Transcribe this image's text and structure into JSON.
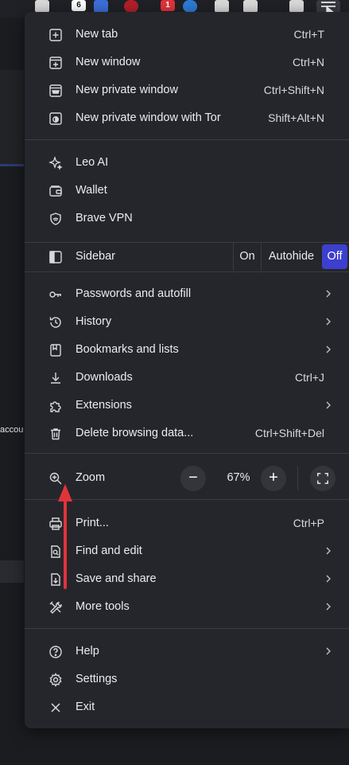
{
  "toolbar": {
    "badges": [
      "6",
      "1"
    ],
    "colors": {
      "bg": "#202126",
      "badge_red": "#e0343b"
    }
  },
  "background": {
    "partial_text": "accoun"
  },
  "menu": {
    "group1": [
      {
        "icon": "new-tab-icon",
        "label": "New tab",
        "shortcut": "Ctrl+T"
      },
      {
        "icon": "new-window-icon",
        "label": "New window",
        "shortcut": "Ctrl+N"
      },
      {
        "icon": "private-window-icon",
        "label": "New private window",
        "shortcut": "Ctrl+Shift+N"
      },
      {
        "icon": "tor-window-icon",
        "label": "New private window with Tor",
        "shortcut": "Shift+Alt+N"
      }
    ],
    "group2": [
      {
        "icon": "sparkle-icon",
        "label": "Leo AI"
      },
      {
        "icon": "wallet-icon",
        "label": "Wallet"
      },
      {
        "icon": "vpn-shield-icon",
        "label": "Brave VPN"
      }
    ],
    "sidebar": {
      "label": "Sidebar",
      "options": [
        "On",
        "Autohide",
        "Off"
      ],
      "selected": "Off",
      "accent": "#3d3fcf"
    },
    "group3": [
      {
        "icon": "key-icon",
        "label": "Passwords and autofill",
        "submenu": true
      },
      {
        "icon": "history-icon",
        "label": "History",
        "submenu": true
      },
      {
        "icon": "bookmark-icon",
        "label": "Bookmarks and lists",
        "submenu": true
      },
      {
        "icon": "download-icon",
        "label": "Downloads",
        "shortcut": "Ctrl+J"
      },
      {
        "icon": "puzzle-icon",
        "label": "Extensions",
        "submenu": true
      },
      {
        "icon": "trash-icon",
        "label": "Delete browsing data...",
        "shortcut": "Ctrl+Shift+Del"
      }
    ],
    "zoom": {
      "label": "Zoom",
      "value": "67%",
      "minus": "−",
      "plus": "+"
    },
    "group4": [
      {
        "icon": "print-icon",
        "label": "Print...",
        "shortcut": "Ctrl+P"
      },
      {
        "icon": "find-icon",
        "label": "Find and edit",
        "submenu": true
      },
      {
        "icon": "save-icon",
        "label": "Save and share",
        "submenu": true
      },
      {
        "icon": "tools-icon",
        "label": "More tools",
        "submenu": true
      }
    ],
    "group5": [
      {
        "icon": "help-icon",
        "label": "Help",
        "submenu": true
      },
      {
        "icon": "settings-gear-icon",
        "label": "Settings"
      },
      {
        "icon": "close-x-icon",
        "label": "Exit"
      }
    ]
  },
  "annotation": {
    "color": "#e0343b"
  }
}
